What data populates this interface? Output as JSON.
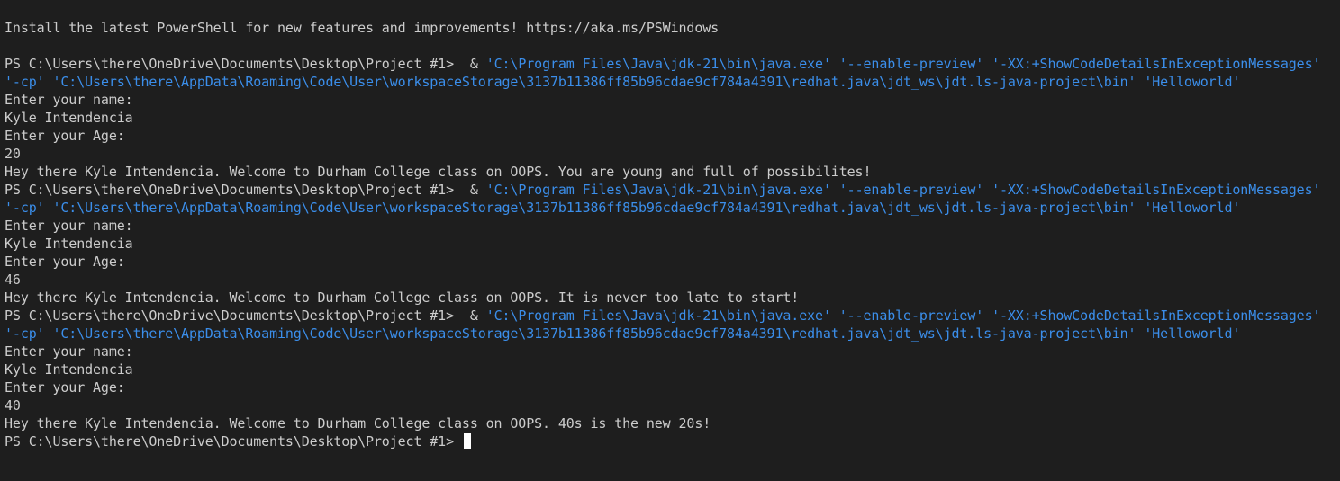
{
  "terminal": {
    "lines": [
      "Install the latest PowerShell for new features and improvements! https://aka.ms/PSWindows",
      "",
      "PS C:\\Users\\there\\OneDrive\\Documents\\Desktop\\Project #1>",
      "'-cp'",
      "Enter your name:",
      "Kyle Intendencia",
      "Enter your Age:",
      "20",
      "Hey there Kyle Intendencia. Welcome to Durham College class on OOPS. You are young and full of possibilites!",
      "PS C:\\Users\\there\\OneDrive\\Documents\\Desktop\\Project #1>",
      "'-cp'",
      "Enter your name:",
      "Kyle Intendencia",
      "Enter your Age:",
      "46",
      "Hey there Kyle Intendencia. Welcome to Durham College class on OOPS. It is never too late to start!",
      "PS C:\\Users\\there\\OneDrive\\Documents\\Desktop\\Project #1>",
      "'-cp'",
      "Enter your name:",
      "Kyle Intendencia",
      "Enter your Age:",
      "40",
      "Hey there Kyle Intendencia. Welcome to Durham College class on OOPS. 40s is the new 20s!",
      "PS C:\\Users\\there\\OneDrive\\Documents\\Desktop\\Project #1>"
    ],
    "command_ampersand": "&",
    "command_args": "'C:\\Program Files\\Java\\jdk-21\\bin\\java.exe' '--enable-preview' '-XX:+ShowCodeDetailsInExceptionMessages'",
    "classpath_args": "'C:\\Users\\there\\AppData\\Roaming\\Code\\User\\workspaceStorage\\3137b11386ff85b96cdae9cf784a4391\\redhat.java\\jdt_ws\\jdt.ls-java-project\\bin' 'Helloworld'"
  },
  "colors": {
    "background": "#1e1e1e",
    "foreground": "#cccccc",
    "string": "#3b8eea",
    "cursor": "#ffffff"
  }
}
